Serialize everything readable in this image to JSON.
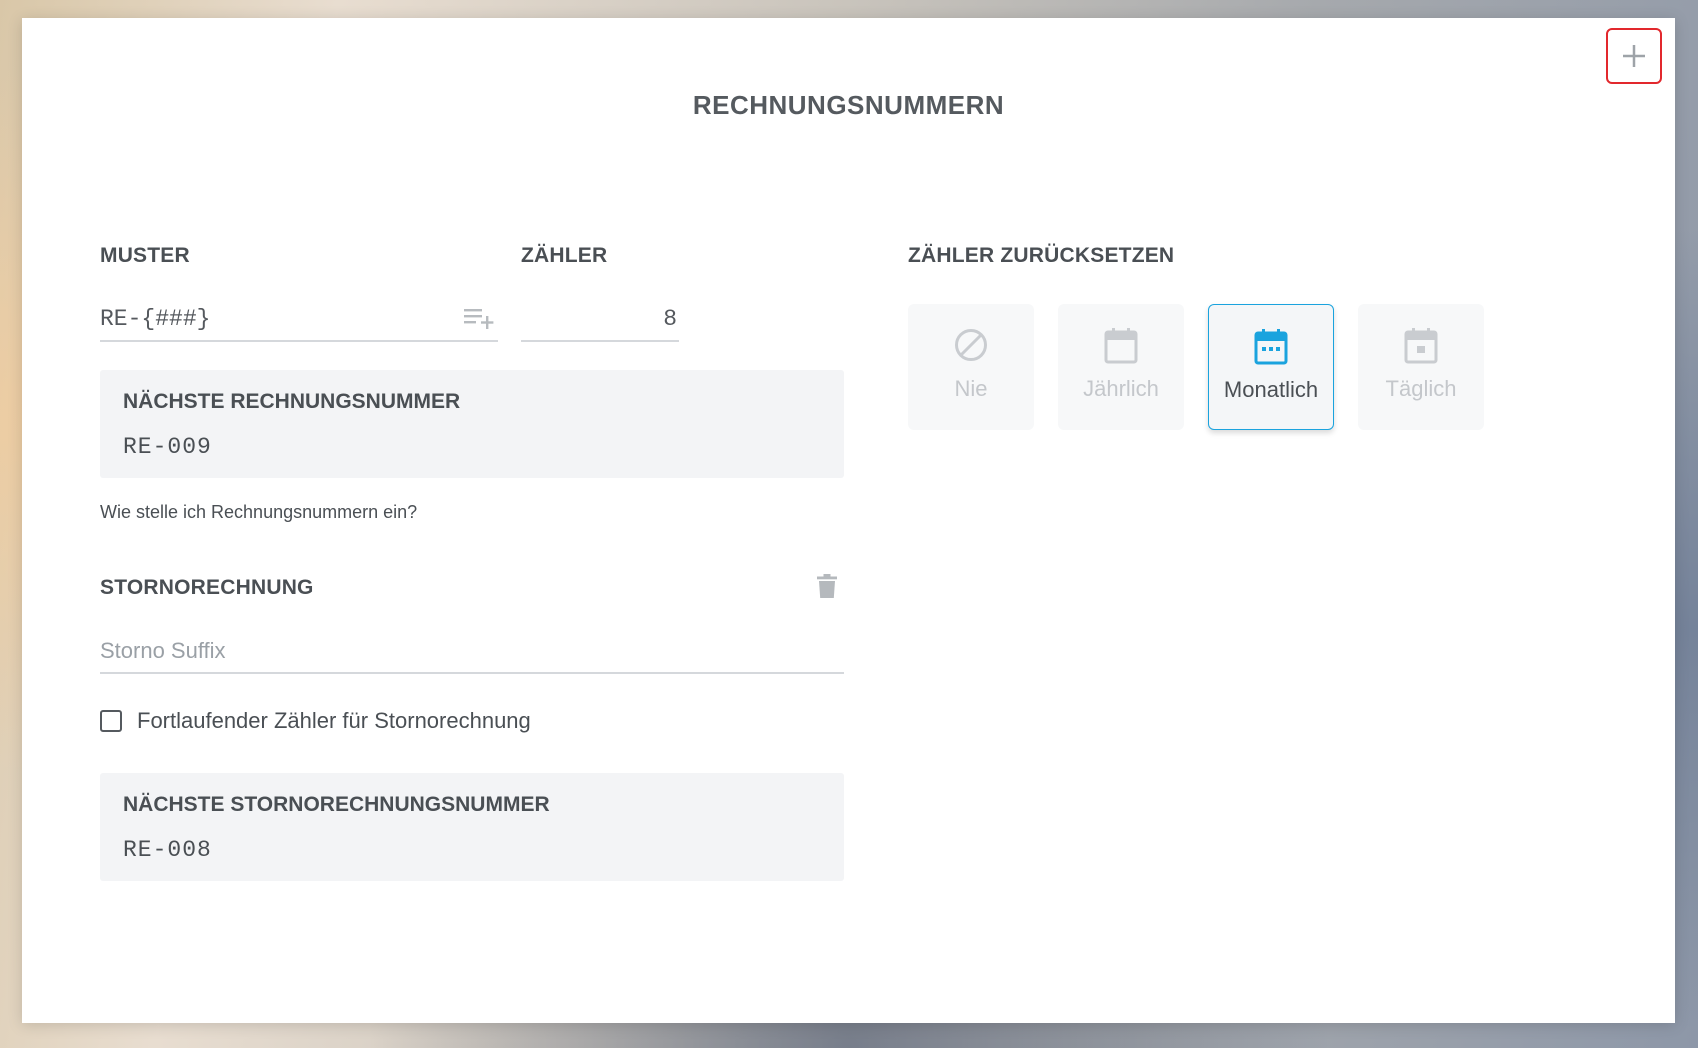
{
  "page": {
    "title": "RECHNUNGSNUMMERN",
    "add_icon": "plus-icon"
  },
  "muster": {
    "label": "MUSTER",
    "value": "RE-{###}",
    "action_icon": "playlist-add-icon"
  },
  "zaehler": {
    "label": "ZÄHLER",
    "value": "8"
  },
  "next_invoice": {
    "label": "NÄCHSTE RECHNUNGSNUMMER",
    "value": "RE-009"
  },
  "help_link": "Wie stelle ich Rechnungsnummern ein?",
  "storno": {
    "label": "STORNORECHNUNG",
    "delete_icon": "trash-icon",
    "suffix_placeholder": "Storno Suffix",
    "suffix_value": "",
    "checkbox_label": "Fortlaufender Zähler für Stornorechnung",
    "checkbox_checked": false
  },
  "next_storno": {
    "label": "NÄCHSTE STORNORECHNUNGSNUMMER",
    "value": "RE-008"
  },
  "reset": {
    "label": "ZÄHLER ZURÜCKSETZEN",
    "selected": "Monatlich",
    "options": [
      {
        "label": "Nie",
        "icon": "block-icon"
      },
      {
        "label": "Jährlich",
        "icon": "calendar-blank-icon"
      },
      {
        "label": "Monatlich",
        "icon": "calendar-month-icon"
      },
      {
        "label": "Täglich",
        "icon": "calendar-day-icon"
      }
    ]
  },
  "colors": {
    "accent": "#1aa3de",
    "highlight_border": "#e2282d",
    "text": "#4a4f54",
    "muted": "#c4c7cb"
  }
}
